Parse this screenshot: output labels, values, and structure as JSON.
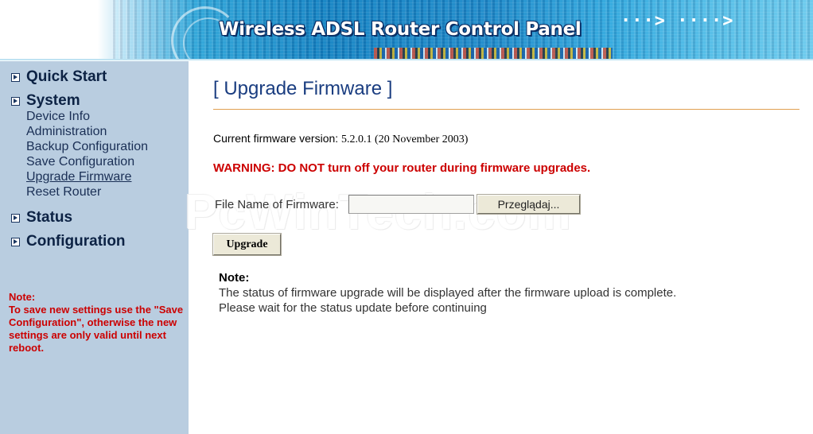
{
  "header": {
    "title": "Wireless ADSL Router Control Panel",
    "arrows": "···> ····>"
  },
  "sidebar": {
    "sections": [
      {
        "label": "Quick Start"
      },
      {
        "label": "System",
        "items": [
          "Device Info",
          "Administration",
          "Backup Configuration",
          "Save Configuration",
          "Upgrade Firmware",
          "Reset Router"
        ]
      },
      {
        "label": "Status"
      },
      {
        "label": "Configuration"
      }
    ],
    "active_item": "Upgrade Firmware",
    "note_title": "Note:",
    "note_body": "To save new settings use the \"Save Configuration\", otherwise the new settings are only valid until next reboot."
  },
  "main": {
    "title": "[ Upgrade Firmware ]",
    "firmware_label": "Current firmware version:",
    "firmware_value": "5.2.0.1 (20 November 2003)",
    "warning": "WARNING: DO NOT turn off your router during firmware upgrades.",
    "file_label": "File Name of Firmware:",
    "file_value": "",
    "browse_label": "Przeglądaj...",
    "upgrade_label": "Upgrade",
    "note_title": "Note:",
    "note_line1": "The status of firmware upgrade will be displayed after the firmware upload is complete.",
    "note_line2": "Please wait for the status update before continuing"
  },
  "watermark": "PcWinTech.com",
  "colors": {
    "sidebar_bg": "#b9cde0",
    "title_blue": "#1a3d80",
    "warning_red": "#cc0000",
    "rule_orange": "#e0a050"
  }
}
